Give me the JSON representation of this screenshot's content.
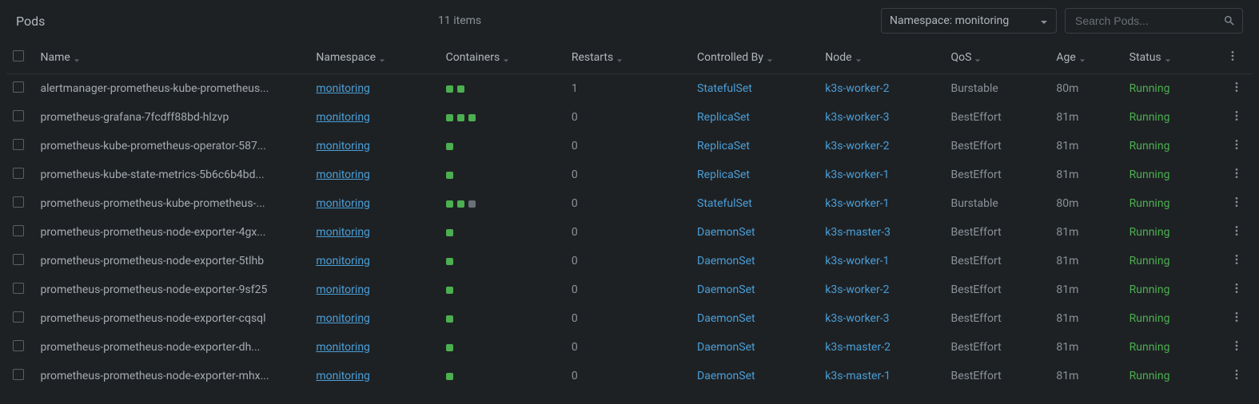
{
  "header": {
    "title": "Pods",
    "item_count": "11 items",
    "namespace_select": "Namespace: monitoring",
    "search_placeholder": "Search Pods..."
  },
  "columns": {
    "name": "Name",
    "namespace": "Namespace",
    "containers": "Containers",
    "restarts": "Restarts",
    "controlled_by": "Controlled By",
    "node": "Node",
    "qos": "QoS",
    "age": "Age",
    "status": "Status"
  },
  "rows": [
    {
      "name": "alertmanager-prometheus-kube-prometheus...",
      "namespace": "monitoring",
      "containers": [
        "green",
        "green"
      ],
      "restarts": "1",
      "controlled_by": "StatefulSet",
      "node": "k3s-worker-2",
      "qos": "Burstable",
      "age": "80m",
      "status": "Running"
    },
    {
      "name": "prometheus-grafana-7fcdff88bd-hlzvp",
      "namespace": "monitoring",
      "containers": [
        "green",
        "green",
        "green"
      ],
      "restarts": "0",
      "controlled_by": "ReplicaSet",
      "node": "k3s-worker-3",
      "qos": "BestEffort",
      "age": "81m",
      "status": "Running"
    },
    {
      "name": "prometheus-kube-prometheus-operator-587...",
      "namespace": "monitoring",
      "containers": [
        "green"
      ],
      "restarts": "0",
      "controlled_by": "ReplicaSet",
      "node": "k3s-worker-2",
      "qos": "BestEffort",
      "age": "81m",
      "status": "Running"
    },
    {
      "name": "prometheus-kube-state-metrics-5b6c6b4bd...",
      "namespace": "monitoring",
      "containers": [
        "green"
      ],
      "restarts": "0",
      "controlled_by": "ReplicaSet",
      "node": "k3s-worker-1",
      "qos": "BestEffort",
      "age": "81m",
      "status": "Running"
    },
    {
      "name": "prometheus-prometheus-kube-prometheus-...",
      "namespace": "monitoring",
      "containers": [
        "green",
        "green",
        "gray"
      ],
      "restarts": "0",
      "controlled_by": "StatefulSet",
      "node": "k3s-worker-1",
      "qos": "Burstable",
      "age": "80m",
      "status": "Running"
    },
    {
      "name": "prometheus-prometheus-node-exporter-4gx...",
      "namespace": "monitoring",
      "containers": [
        "green"
      ],
      "restarts": "0",
      "controlled_by": "DaemonSet",
      "node": "k3s-master-3",
      "qos": "BestEffort",
      "age": "81m",
      "status": "Running"
    },
    {
      "name": "prometheus-prometheus-node-exporter-5tlhb",
      "namespace": "monitoring",
      "containers": [
        "green"
      ],
      "restarts": "0",
      "controlled_by": "DaemonSet",
      "node": "k3s-worker-1",
      "qos": "BestEffort",
      "age": "81m",
      "status": "Running"
    },
    {
      "name": "prometheus-prometheus-node-exporter-9sf25",
      "namespace": "monitoring",
      "containers": [
        "green"
      ],
      "restarts": "0",
      "controlled_by": "DaemonSet",
      "node": "k3s-worker-2",
      "qos": "BestEffort",
      "age": "81m",
      "status": "Running"
    },
    {
      "name": "prometheus-prometheus-node-exporter-cqsql",
      "namespace": "monitoring",
      "containers": [
        "green"
      ],
      "restarts": "0",
      "controlled_by": "DaemonSet",
      "node": "k3s-worker-3",
      "qos": "BestEffort",
      "age": "81m",
      "status": "Running"
    },
    {
      "name": "prometheus-prometheus-node-exporter-dh...",
      "namespace": "monitoring",
      "containers": [
        "green"
      ],
      "restarts": "0",
      "controlled_by": "DaemonSet",
      "node": "k3s-master-2",
      "qos": "BestEffort",
      "age": "81m",
      "status": "Running"
    },
    {
      "name": "prometheus-prometheus-node-exporter-mhx...",
      "namespace": "monitoring",
      "containers": [
        "green"
      ],
      "restarts": "0",
      "controlled_by": "DaemonSet",
      "node": "k3s-master-1",
      "qos": "BestEffort",
      "age": "81m",
      "status": "Running"
    }
  ]
}
